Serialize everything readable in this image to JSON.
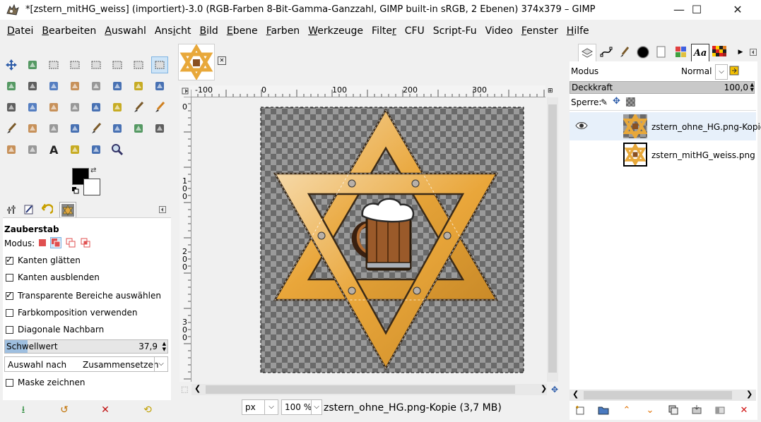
{
  "window": {
    "title": "*[zstern_mitHG_weiss] (importiert)-3.0 (RGB-Farben 8-Bit-Gamma-Ganzzahl, GIMP built-in sRGB, 2 Ebenen) 374x379 – GIMP",
    "minimize": "—",
    "maximize": "☐",
    "close": "✕"
  },
  "menu": [
    {
      "u": "D",
      "rest": "atei"
    },
    {
      "u": "B",
      "rest": "earbeiten"
    },
    {
      "u": "A",
      "rest": "uswahl"
    },
    {
      "pre": "Ans",
      "u": "i",
      "rest": "cht"
    },
    {
      "u": "B",
      "rest": "ild"
    },
    {
      "u": "E",
      "rest": "bene"
    },
    {
      "u": "F",
      "rest": "arben"
    },
    {
      "u": "W",
      "rest": "erkzeuge"
    },
    {
      "pre": "Filte",
      "u": "r",
      "rest": ""
    },
    {
      "pre": "CFU",
      "u": "",
      "rest": ""
    },
    {
      "pre": "Script-Fu",
      "u": "",
      "rest": ""
    },
    {
      "pre": "Video",
      "u": "",
      "rest": ""
    },
    {
      "u": "F",
      "rest": "enster"
    },
    {
      "u": "H",
      "rest": "ilfe"
    }
  ],
  "tool_options": {
    "title": "Zauberstab",
    "mode_label": "Modus:",
    "antialias": "Kanten glätten",
    "feather": "Kanten ausblenden",
    "select_transparent": "Transparente Bereiche auswählen",
    "sample_merged": "Farbkomposition verwenden",
    "diagonal": "Diagonale Nachbarn",
    "threshold_label": "Schwellwert",
    "threshold_value": "37,9",
    "select_by_label": "Auswahl nach",
    "select_by_value": "Zusammensetzen",
    "draw_mask": "Maske zeichnen"
  },
  "ruler": {
    "top_ticks": [
      "-100",
      "0",
      "100",
      "200",
      "300"
    ],
    "left_ticks": [
      "0",
      "1\n0\n0",
      "2\n0\n0",
      "3\n0\n0"
    ]
  },
  "status": {
    "unit": "px",
    "zoom": "100 %",
    "info": "zstern_ohne_HG.png-Kopie (3,7 MB)"
  },
  "layers": {
    "mode_label": "Modus",
    "mode_value": "Normal",
    "opacity_label": "Deckkraft",
    "opacity_value": "100,0",
    "lock_label": "Sperre:",
    "items": [
      {
        "name": "zstern_ohne_HG.png-Kopie",
        "visible": true
      },
      {
        "name": "zstern_mitHG_weiss.png",
        "visible": false
      }
    ]
  },
  "colors": {
    "star_gold": "#e8a83a",
    "star_outline": "#4a3520",
    "active_tool_bg": "#cde4f7"
  }
}
